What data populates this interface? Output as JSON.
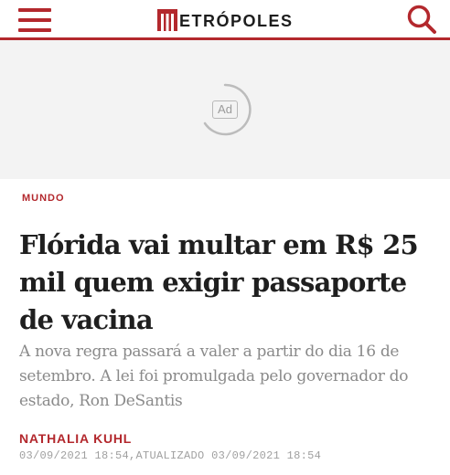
{
  "header": {
    "logo_text": "ETRÓPOLES",
    "logo_letter": "M",
    "brand_color": "#b3282d",
    "menu_icon": "hamburger-menu-icon",
    "search_icon": "search-icon"
  },
  "ad": {
    "label": "Ad"
  },
  "article": {
    "section": "MUNDO",
    "headline": "Flórida vai multar em R$ 25 mil quem exigir passaporte de vacina",
    "subtitle": "A nova regra passará a valer a partir do dia 16 de setembro. A lei foi promulgada pelo governador do estado, Ron DeSantis",
    "author": "NATHALIA KUHL",
    "published": "03/09/2021 18:54",
    "updated_label": "ATUALIZADO",
    "updated": "03/09/2021 18:54"
  }
}
